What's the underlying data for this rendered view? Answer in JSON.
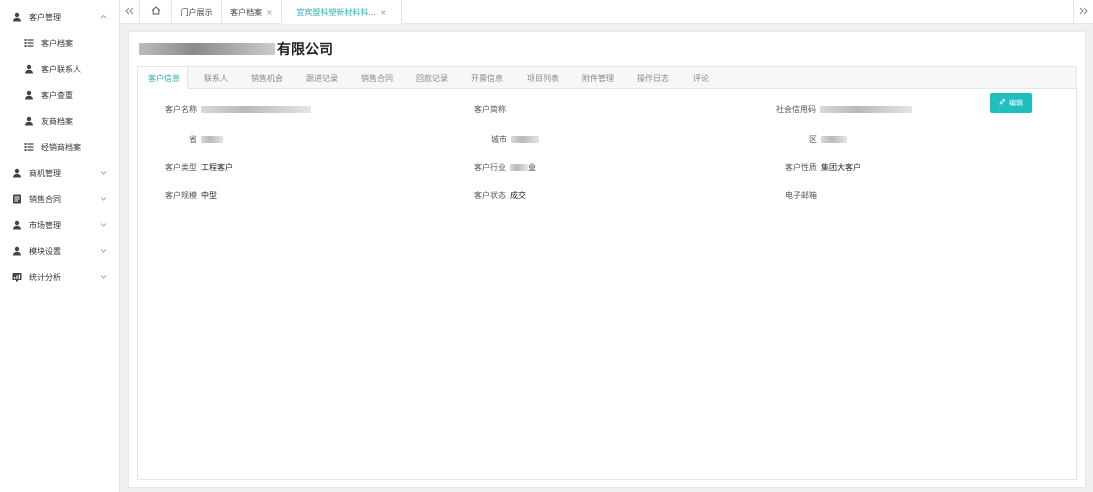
{
  "sidebar": {
    "items": [
      {
        "label": "客户管理",
        "icon": "user-icon",
        "type": "parent",
        "expanded": true
      },
      {
        "label": "客户档案",
        "icon": "list-icon",
        "type": "child"
      },
      {
        "label": "客户联系人",
        "icon": "user-icon",
        "type": "child"
      },
      {
        "label": "客户查重",
        "icon": "user-icon",
        "type": "child"
      },
      {
        "label": "友商档案",
        "icon": "user-icon",
        "type": "child"
      },
      {
        "label": "经销商档案",
        "icon": "list-icon",
        "type": "child"
      },
      {
        "label": "商机管理",
        "icon": "user-icon",
        "type": "parent"
      },
      {
        "label": "销售合同",
        "icon": "document-icon",
        "type": "parent"
      },
      {
        "label": "市场管理",
        "icon": "user-icon",
        "type": "parent"
      },
      {
        "label": "模块设置",
        "icon": "user-icon",
        "type": "parent"
      },
      {
        "label": "统计分析",
        "icon": "chart-icon",
        "type": "parent"
      }
    ]
  },
  "tabbar": {
    "collapse_icon": "double-chevron-left-icon",
    "home_icon": "home-icon",
    "expand_icon": "double-chevron-right-icon",
    "tabs": [
      {
        "label": "门户展示",
        "closable": false
      },
      {
        "label": "客户档案",
        "closable": true
      },
      {
        "label": "宜宾盟科塑新材料科...",
        "closable": true,
        "active": true
      }
    ],
    "close_glyph": "×"
  },
  "main": {
    "company_suffix": "有限公司",
    "subtabs": [
      "客户信息",
      "联系人",
      "销售机会",
      "跟进记录",
      "销售合同",
      "回款记录",
      "开票信息",
      "项目列表",
      "附件管理",
      "操作日志",
      "评论"
    ],
    "fields": {
      "customer_name": {
        "label": "客户名称",
        "value": ""
      },
      "short_name": {
        "label": "客户简称",
        "value": ""
      },
      "credit_code": {
        "label": "社会信用码",
        "value": ""
      },
      "province": {
        "label": "省",
        "value": ""
      },
      "city": {
        "label": "城市",
        "value": ""
      },
      "district": {
        "label": "区",
        "value": ""
      },
      "customer_type": {
        "label": "客户类型",
        "value": "工程客户"
      },
      "industry": {
        "label": "客户行业",
        "value": "业"
      },
      "nature": {
        "label": "客户性质",
        "value": "集团大客户"
      },
      "scale": {
        "label": "客户规模",
        "value": "中型"
      },
      "status": {
        "label": "客户状态",
        "value": "成交"
      },
      "email": {
        "label": "电子邮箱",
        "value": ""
      }
    },
    "edit_label": "编辑"
  },
  "colors": {
    "accent": "#29b0b6",
    "button": "#1ebfbf"
  }
}
